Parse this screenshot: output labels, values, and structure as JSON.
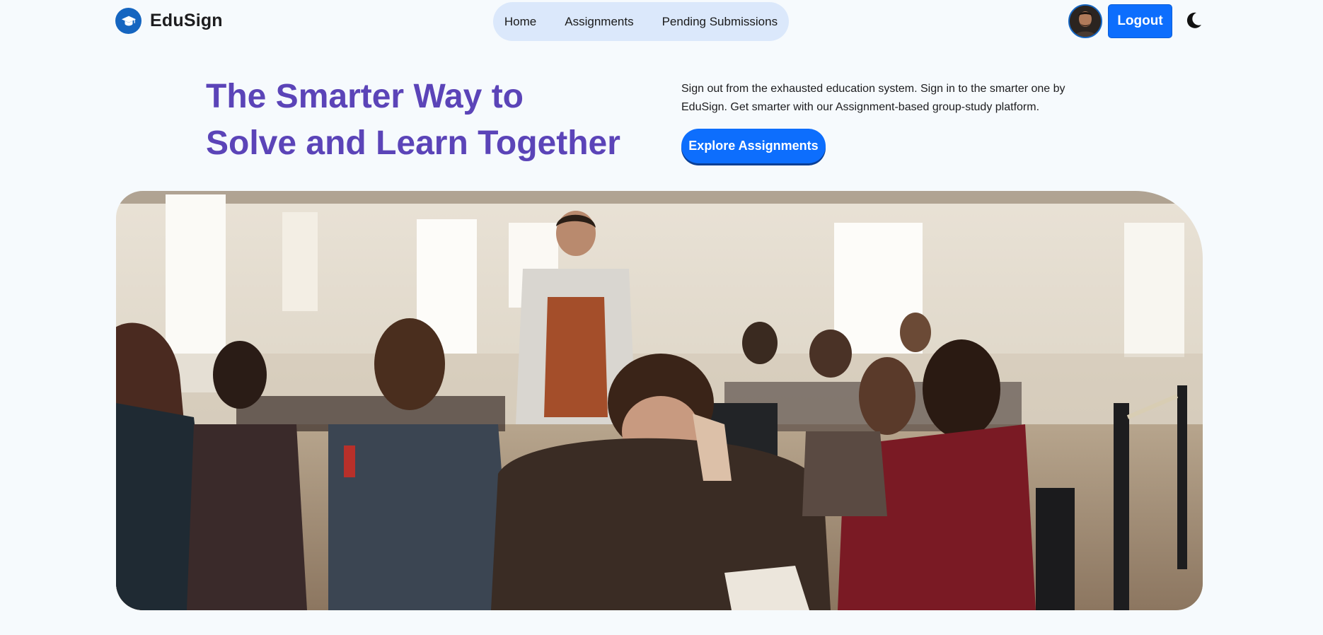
{
  "brand": {
    "name": "EduSign",
    "logo_icon": "graduation-cap-icon",
    "logo_color": "#1565c0"
  },
  "nav": {
    "links": [
      {
        "label": "Home"
      },
      {
        "label": "Assignments"
      },
      {
        "label": "Pending Submissions"
      }
    ],
    "pill_color": "#dbe8fb"
  },
  "user": {
    "avatar_icon": "user-avatar",
    "logout_label": "Logout",
    "theme_toggle_icon": "moon-icon"
  },
  "hero": {
    "title_line1": "The Smarter Way to",
    "title_line2": "Solve and Learn Together",
    "description": "Sign out from the exhausted education system. Sign in to the smarter one by EduSign. Get smarter with our Assignment-based group-study platform.",
    "cta_label": "Explore Assignments",
    "image_subject": "students studying together at tables in a bright classroom"
  },
  "colors": {
    "accent": "#0d6efd",
    "title": "#5b44b8",
    "background": "#f6fafd"
  }
}
